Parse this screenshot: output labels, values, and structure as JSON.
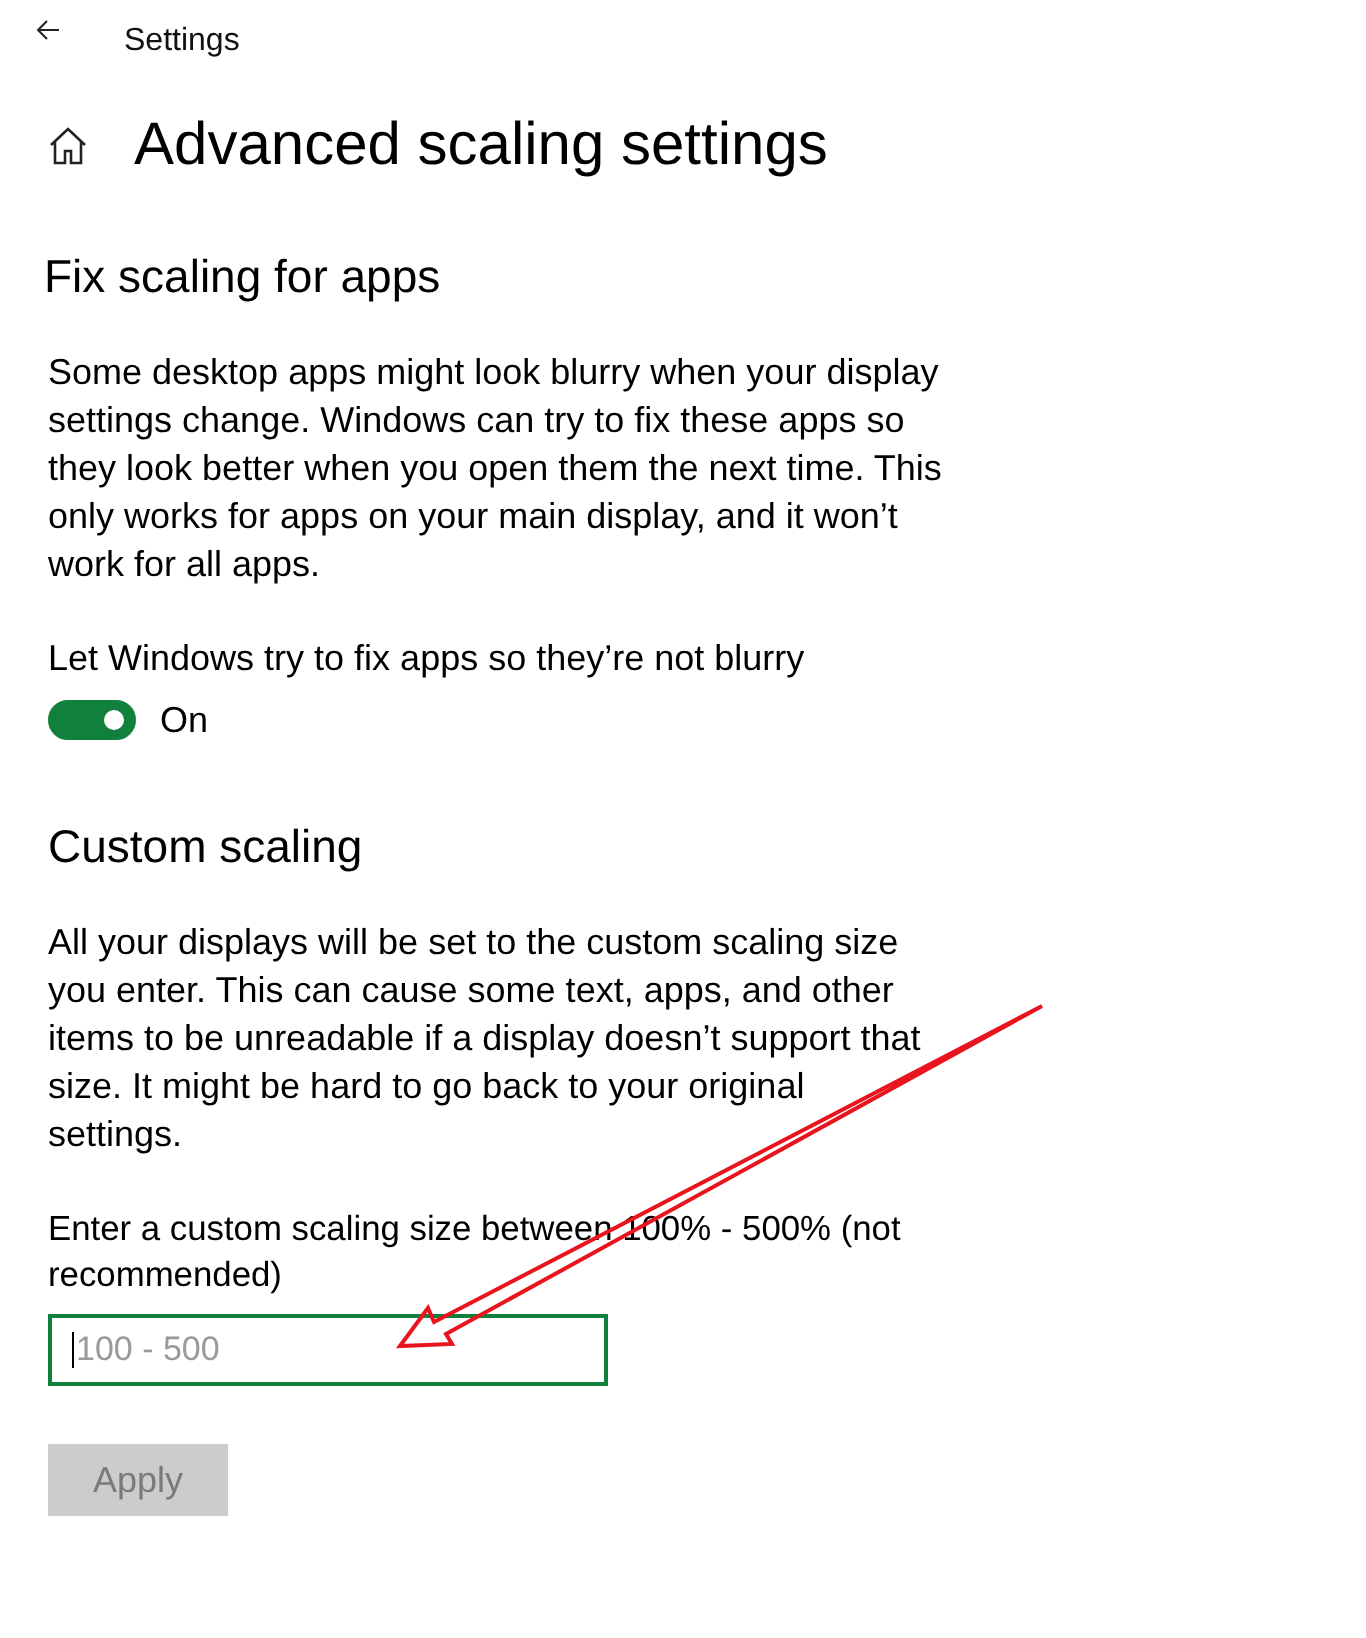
{
  "window": {
    "title": "Settings"
  },
  "page": {
    "title": "Advanced scaling settings"
  },
  "fix_scaling": {
    "heading": "Fix scaling for apps",
    "description": "Some desktop apps might look blurry when your display settings change. Windows can try to fix these apps so they look better when you open them the next time. This only works for apps on your main display, and it won’t work for all apps.",
    "toggle": {
      "label": "Let Windows try to fix apps so they’re not blurry",
      "on": true,
      "state_text": "On"
    }
  },
  "custom_scaling": {
    "heading": "Custom scaling",
    "description": "All your displays will be set to the custom scaling size you enter. This can cause some text, apps, and other items to be unreadable if a display doesn’t support that size. It might be hard to go back to your original settings.",
    "field": {
      "label": "Enter a custom scaling size between 100% - 500% (not recommended)",
      "placeholder": "100 - 500",
      "focused": true
    },
    "button": {
      "label": "Apply",
      "disabled": true
    }
  }
}
